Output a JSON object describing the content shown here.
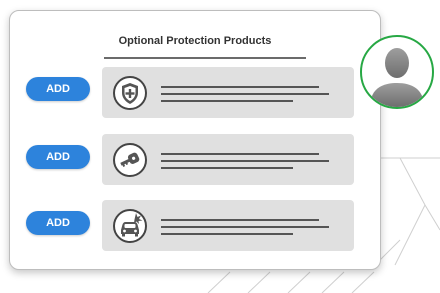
{
  "panel": {
    "title": "Optional Protection Products"
  },
  "products": [
    {
      "button_label": "ADD",
      "icon": "shield-plus-icon"
    },
    {
      "button_label": "ADD",
      "icon": "car-key-icon"
    },
    {
      "button_label": "ADD",
      "icon": "car-damage-icon"
    }
  ],
  "user": {
    "icon": "user-silhouette-icon"
  },
  "colors": {
    "button": "#2d83dc",
    "row_background": "#e0e0e0",
    "avatar_border": "#27a844"
  }
}
